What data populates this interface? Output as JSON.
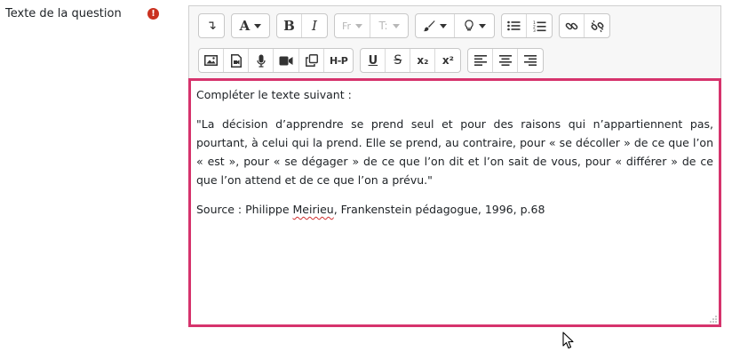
{
  "field": {
    "label": "Texte de la question",
    "required_icon": "!"
  },
  "toolbar": {
    "row1": [
      {
        "name": "collapse",
        "icon": "collapse-arrow-icon",
        "glyph": "↴"
      },
      {
        "name": "style",
        "label": "A",
        "dropdown": true
      },
      {
        "name": "bold",
        "label": "B"
      },
      {
        "name": "italic",
        "label": "I"
      },
      {
        "name": "font",
        "label": "Fr",
        "dropdown": true,
        "disabled": true
      },
      {
        "name": "font-size",
        "label": "T:",
        "dropdown": true,
        "disabled": true
      },
      {
        "name": "brush",
        "icon": "brush-icon",
        "dropdown": true
      },
      {
        "name": "lightbulb",
        "icon": "lightbulb-icon",
        "dropdown": true
      },
      {
        "name": "unordered-list",
        "icon": "unordered-list-icon"
      },
      {
        "name": "ordered-list",
        "icon": "ordered-list-icon"
      },
      {
        "name": "link",
        "icon": "link-icon"
      },
      {
        "name": "unlink",
        "icon": "unlink-icon"
      }
    ],
    "row2": [
      {
        "name": "image",
        "icon": "image-icon"
      },
      {
        "name": "media-file",
        "icon": "media-file-icon"
      },
      {
        "name": "microphone",
        "icon": "microphone-icon"
      },
      {
        "name": "video",
        "icon": "video-camera-icon"
      },
      {
        "name": "copy",
        "icon": "copy-icon"
      },
      {
        "name": "h5p",
        "label": "H-P"
      },
      {
        "name": "underline",
        "label": "U"
      },
      {
        "name": "strikethrough",
        "label": "S"
      },
      {
        "name": "subscript",
        "label": "x₂"
      },
      {
        "name": "superscript",
        "label": "x²"
      },
      {
        "name": "align-left",
        "icon": "align-left-icon"
      },
      {
        "name": "align-center",
        "icon": "align-center-icon"
      },
      {
        "name": "align-right",
        "icon": "align-right-icon"
      }
    ]
  },
  "content": {
    "intro": "Compléter le texte suivant :",
    "quote": "\"La décision d’apprendre se prend seul et pour des raisons qui n’appartiennent pas, pourtant, à celui qui la prend. Elle se prend, au contraire, pour « se décoller » de ce que l’on « est », pour « se dégager » de ce que l’on dit et l’on sait de vous, pour « différer » de ce que l’on attend et de ce que l’on a prévu.\"",
    "source_prefix": "Source : Philippe ",
    "source_name": "Meirieu",
    "source_suffix": ", Frankenstein pédagogue, 1996, p.68"
  },
  "colors": {
    "focus_border": "#d6336c",
    "required": "#ca3120",
    "spellcheck": "#d03030"
  }
}
